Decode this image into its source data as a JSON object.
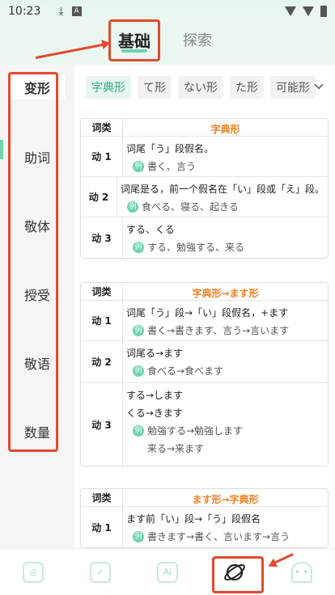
{
  "status": {
    "time": "10:23",
    "download_icon": "download-icon",
    "a_label": "A"
  },
  "header": {
    "tab_basic": "基础",
    "tab_search": "探索"
  },
  "sidebar": {
    "items": [
      {
        "label": "变形"
      },
      {
        "label": "助词"
      },
      {
        "label": "敬体"
      },
      {
        "label": "授受"
      },
      {
        "label": "敬语"
      },
      {
        "label": "数量"
      }
    ]
  },
  "chips": [
    "字典形",
    "て形",
    "ない形",
    "た形",
    "可能形"
  ],
  "tables": [
    {
      "head_type": "词类",
      "head_title": "字典形",
      "rows": [
        {
          "type": "动 1",
          "lines": [
            "词尾「う」段假名。"
          ],
          "examples": [
            "書く、言う"
          ]
        },
        {
          "type": "动 2",
          "lines": [
            "词尾是る，前一个假名在「い」段或「え」段。"
          ],
          "examples": [
            "食べる、寝る、起きる"
          ]
        },
        {
          "type": "动 3",
          "lines": [
            "する、くる"
          ],
          "examples": [
            "する、勉強する、来る"
          ]
        }
      ]
    },
    {
      "head_type": "词类",
      "head_title": "字典形→ます形",
      "rows": [
        {
          "type": "动 1",
          "lines": [
            "词尾「う」段→「い」段假名，+ます"
          ],
          "examples": [
            "書く→書きます、言う→言います"
          ]
        },
        {
          "type": "动 2",
          "lines": [
            "词尾る→ます"
          ],
          "examples": [
            "食べる→食べます"
          ]
        },
        {
          "type": "动 3",
          "lines": [
            "する→します",
            "くる→きます"
          ],
          "examples": [
            "勉強する→勉強します"
          ],
          "extra": "来る→来ます"
        }
      ]
    },
    {
      "head_type": "词类",
      "head_title": "ます形→字典形",
      "rows": [
        {
          "type": "动 1",
          "lines": [
            "ます前「い」段→「う」段假名"
          ],
          "examples": [
            "書きます→書く、言います→言う"
          ]
        }
      ]
    }
  ],
  "example_badge": "例",
  "bottom_nav": [
    {
      "icon": "picture-book-icon"
    },
    {
      "icon": "check-board-icon"
    },
    {
      "icon": "ai-icon",
      "label": "Ai"
    },
    {
      "icon": "planet-icon"
    },
    {
      "icon": "ghost-icon"
    }
  ]
}
